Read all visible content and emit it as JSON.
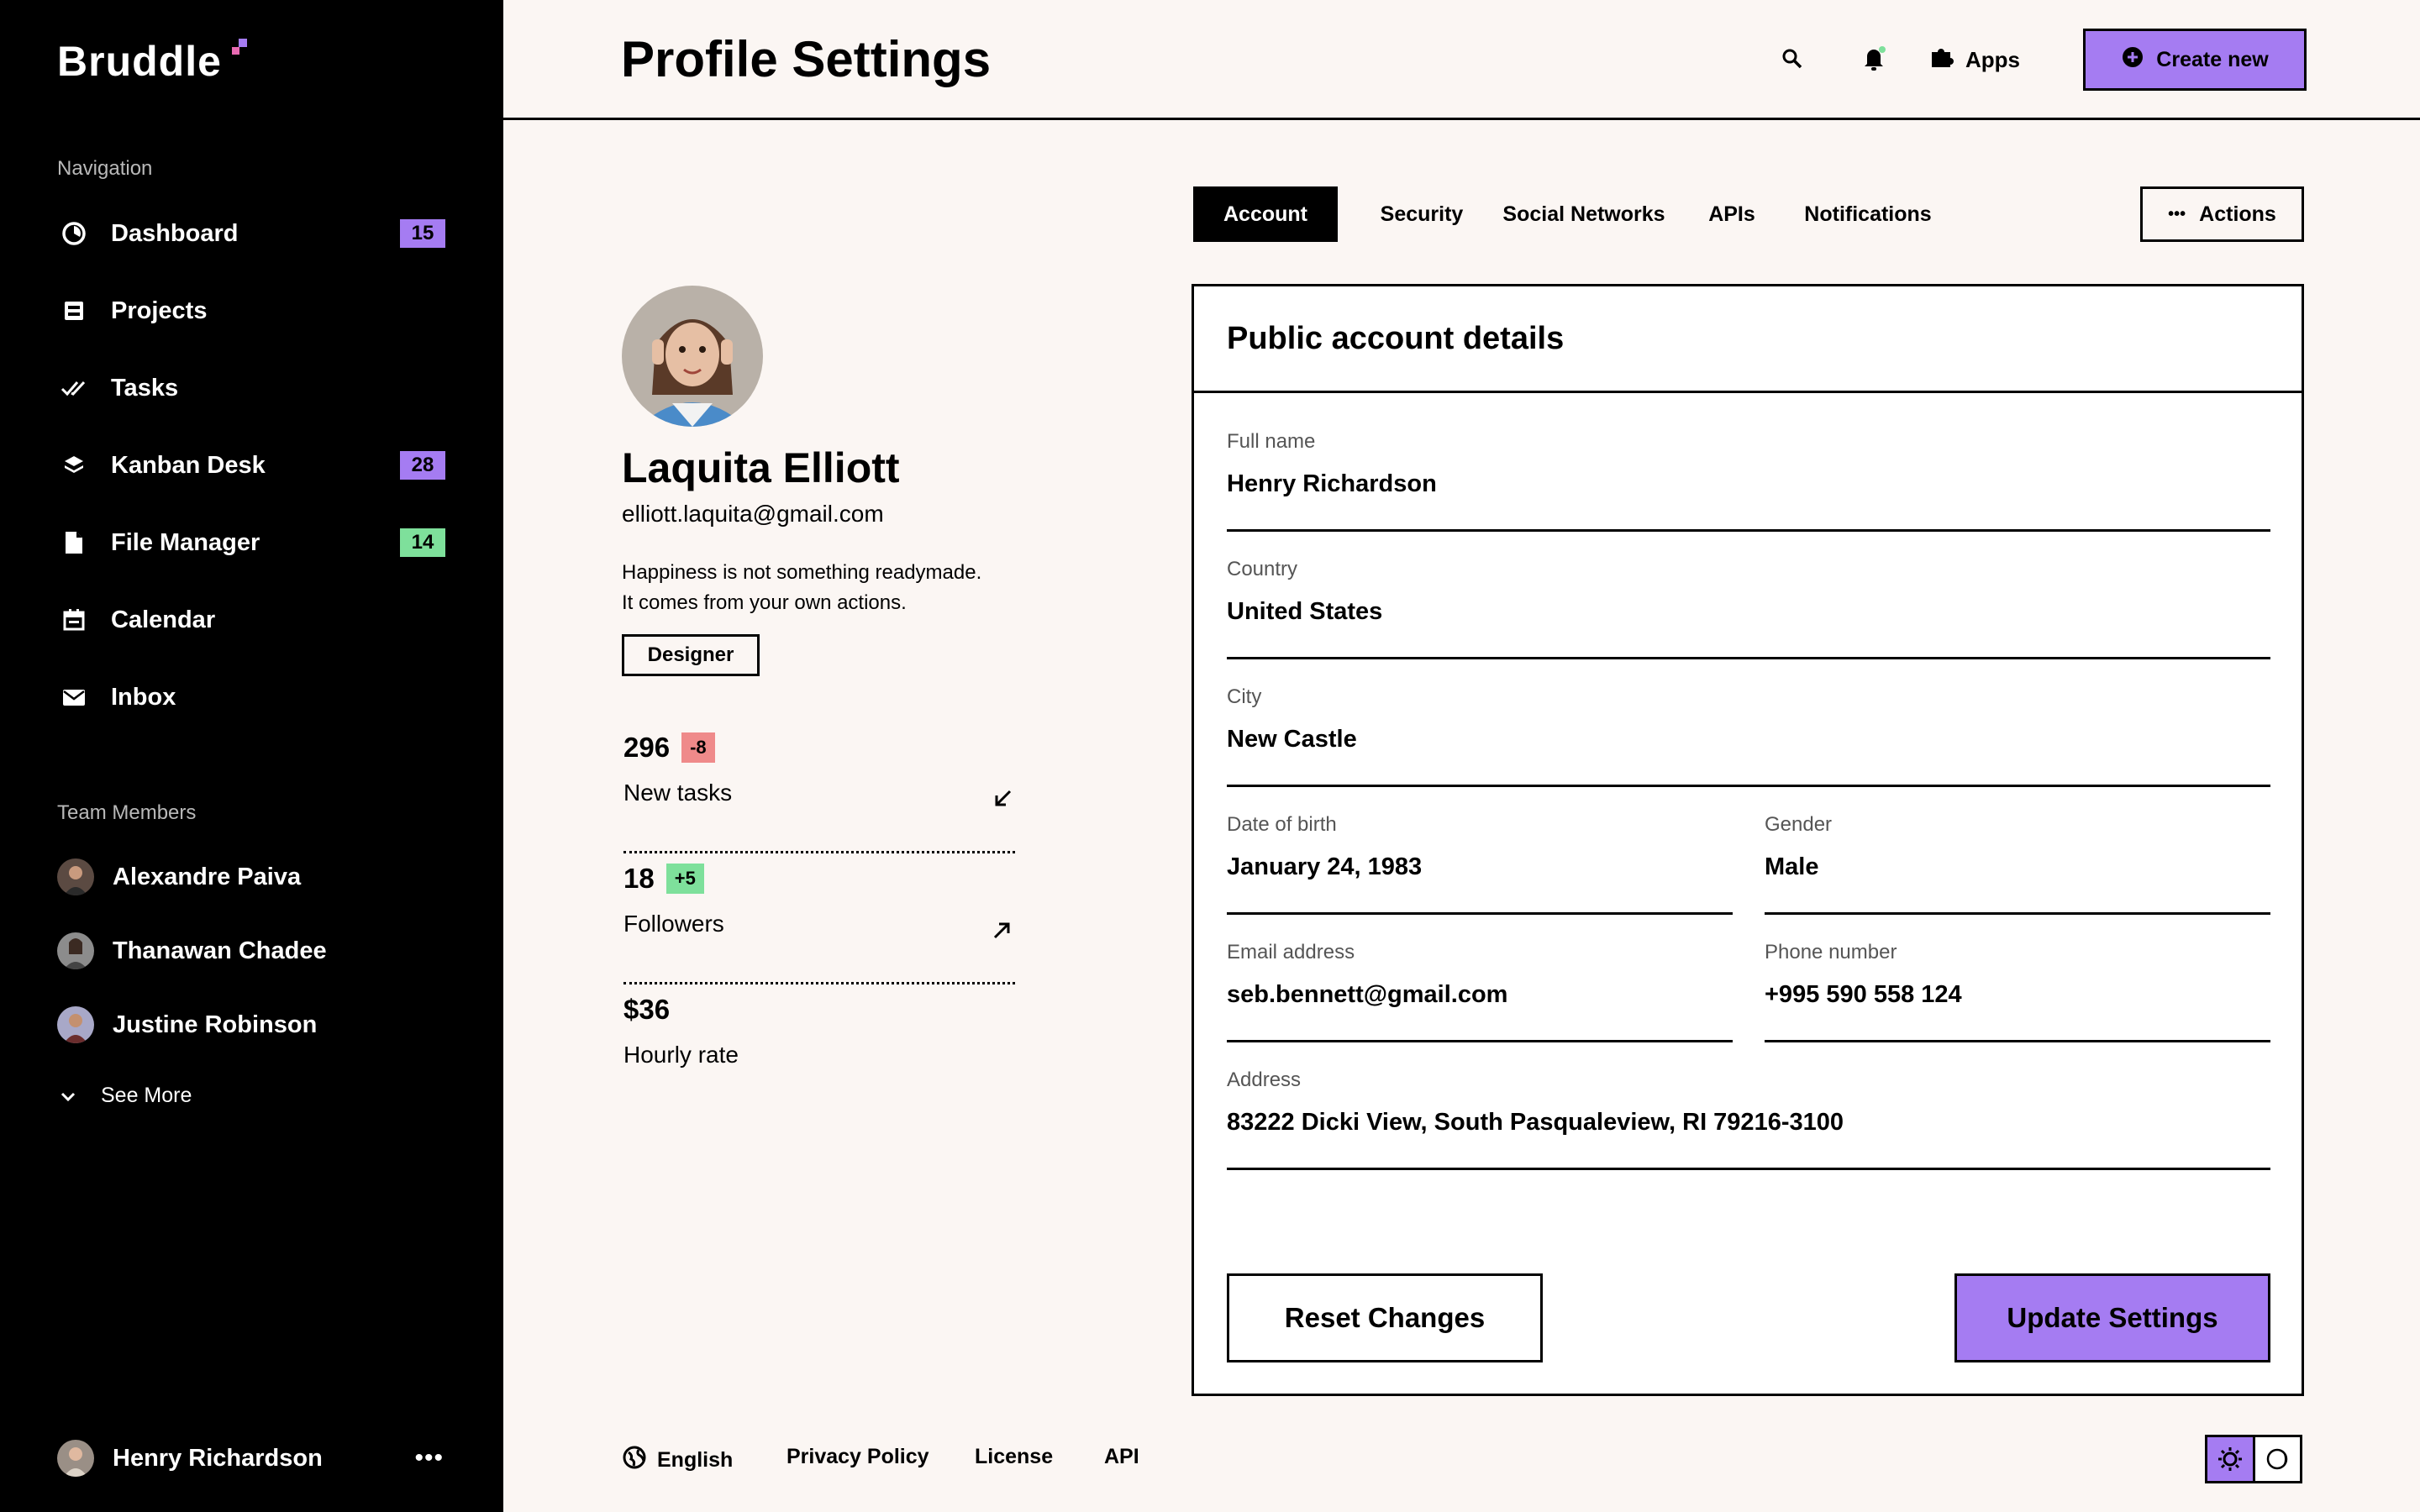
{
  "brand": {
    "name": "Bruddle"
  },
  "sidebar": {
    "nav_title": "Navigation",
    "items": [
      {
        "label": "Dashboard",
        "icon": "dashboard-icon",
        "badge": "15",
        "badge_color": "#a57cf2"
      },
      {
        "label": "Projects",
        "icon": "projects-icon",
        "badge": "",
        "badge_color": ""
      },
      {
        "label": "Tasks",
        "icon": "tasks-icon",
        "badge": "",
        "badge_color": ""
      },
      {
        "label": "Kanban Desk",
        "icon": "kanban-icon",
        "badge": "28",
        "badge_color": "#a57cf2"
      },
      {
        "label": "File Manager",
        "icon": "file-icon",
        "badge": "14",
        "badge_color": "#7ee09b"
      },
      {
        "label": "Calendar",
        "icon": "calendar-icon",
        "badge": "",
        "badge_color": ""
      },
      {
        "label": "Inbox",
        "icon": "inbox-icon",
        "badge": "",
        "badge_color": ""
      }
    ],
    "team_title": "Team Members",
    "members": [
      {
        "name": "Alexandre Paiva"
      },
      {
        "name": "Thanawan Chadee"
      },
      {
        "name": "Justine Robinson"
      }
    ],
    "see_more": "See More",
    "current_user": {
      "name": "Henry Richardson"
    }
  },
  "header": {
    "title": "Profile Settings",
    "apps_label": "Apps",
    "create_label": "Create new"
  },
  "profile": {
    "name": "Laquita Elliott",
    "email": "elliott.laquita@gmail.com",
    "bio_line1": "Happiness is not something readymade.",
    "bio_line2": "It comes from your own actions.",
    "role": "Designer",
    "stats": [
      {
        "value": "296",
        "delta": "-8",
        "label": "New tasks",
        "trend": "down"
      },
      {
        "value": "18",
        "delta": "+5",
        "label": "Followers",
        "trend": "up"
      },
      {
        "value": "$36",
        "delta": "",
        "label": "Hourly rate",
        "trend": ""
      }
    ]
  },
  "tabs": [
    {
      "label": "Account",
      "active": true
    },
    {
      "label": "Security",
      "active": false
    },
    {
      "label": "Social Networks",
      "active": false
    },
    {
      "label": "APIs",
      "active": false
    },
    {
      "label": "Notifications",
      "active": false
    }
  ],
  "actions_label": "Actions",
  "form": {
    "title": "Public account details",
    "fields": {
      "full_name": {
        "label": "Full name",
        "value": "Henry Richardson"
      },
      "country": {
        "label": "Country",
        "value": "United States"
      },
      "city": {
        "label": "City",
        "value": "New Castle"
      },
      "dob": {
        "label": "Date of birth",
        "value": "January 24, 1983"
      },
      "gender": {
        "label": "Gender",
        "value": "Male"
      },
      "email": {
        "label": "Email address",
        "value": "seb.bennett@gmail.com"
      },
      "phone": {
        "label": "Phone number",
        "value": "+995 590 558 124"
      },
      "address": {
        "label": "Address",
        "value": "83222 Dicki View, South Pasqualeview, RI 79216-3100"
      }
    },
    "reset_label": "Reset Changes",
    "update_label": "Update Settings"
  },
  "footer": {
    "language": "English",
    "privacy": "Privacy Policy",
    "license": "License",
    "api": "API",
    "theme": "light"
  },
  "colors": {
    "accent": "#a57cf2",
    "success": "#7ee09b",
    "danger": "#ef8a8a",
    "background": "#fbf6f3"
  }
}
